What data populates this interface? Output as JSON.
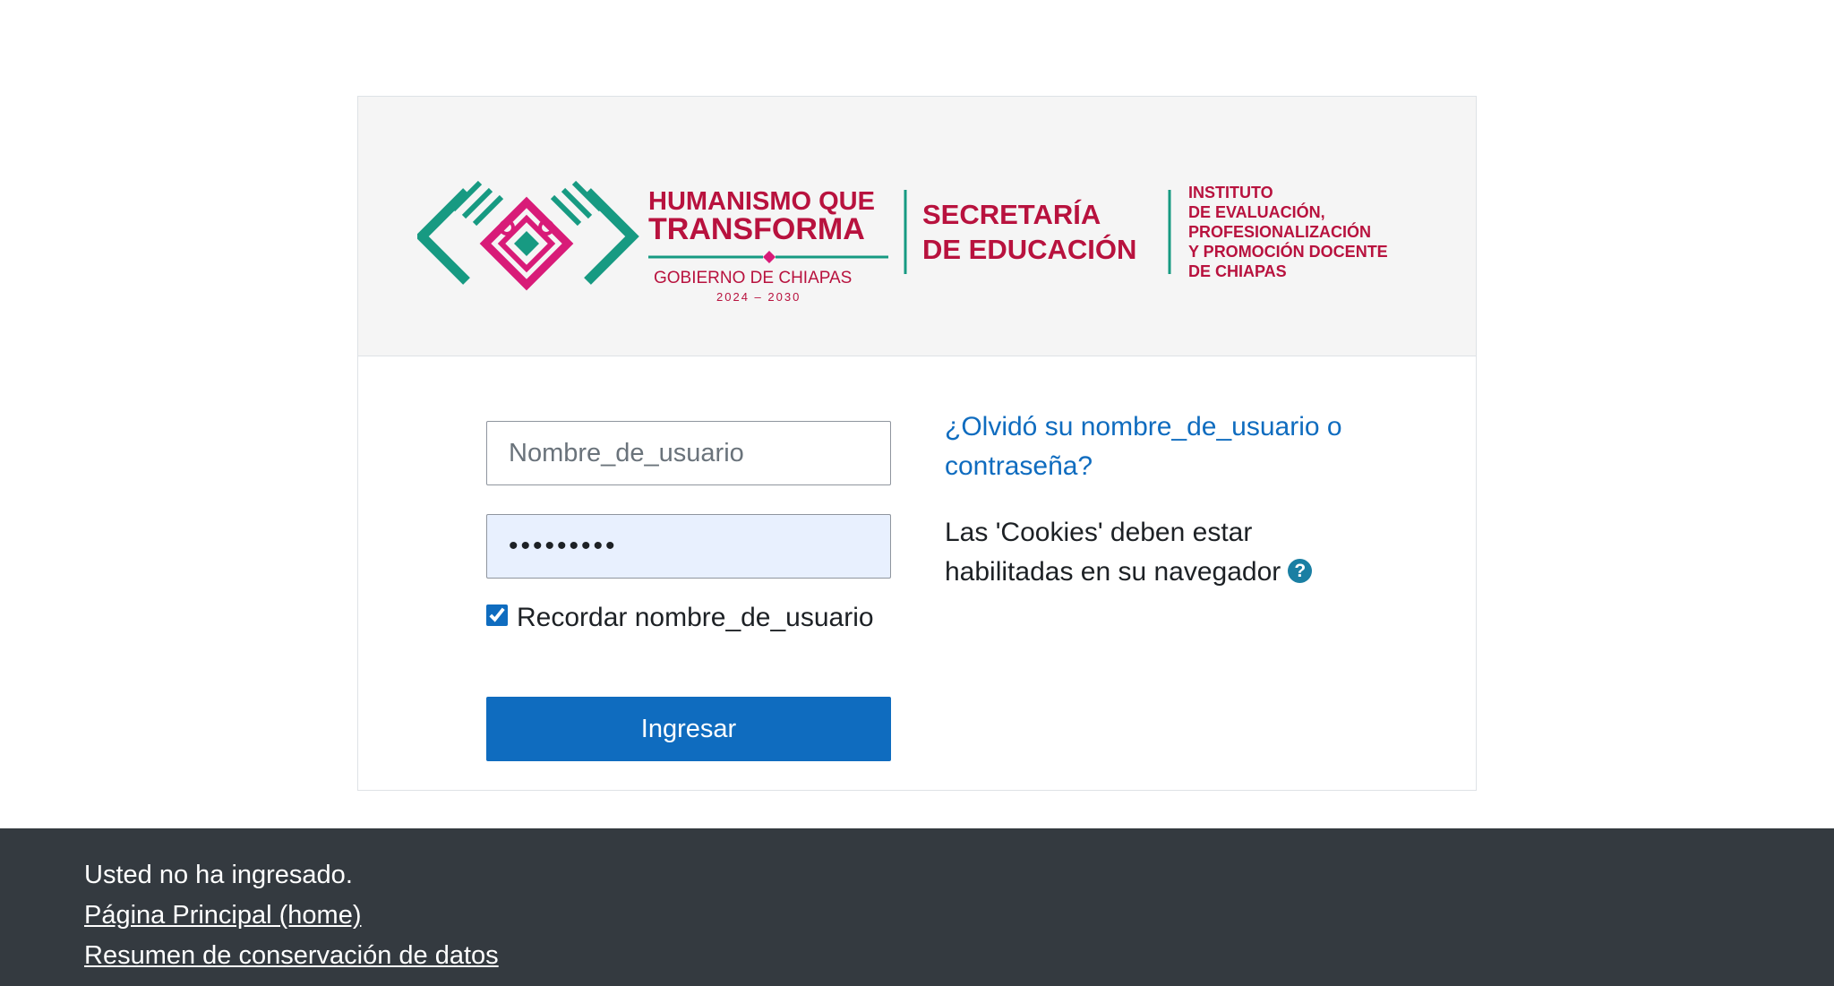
{
  "logo": {
    "motto_line1": "HUMANISMO QUE",
    "motto_line2": "TRANSFORMA",
    "government": "GOBIERNO DE CHIAPAS",
    "years": "2024 – 2030",
    "secretaria_line1": "SECRETARÍA",
    "secretaria_line2": "DE EDUCACIÓN",
    "instituto_line1": "INSTITUTO",
    "instituto_line2": "DE EVALUACIÓN,",
    "instituto_line3": "PROFESIONALIZACIÓN",
    "instituto_line4": "Y PROMOCIÓN DOCENTE",
    "instituto_line5": "DE CHIAPAS",
    "colors": {
      "brand_red": "#b8123e",
      "brand_green": "#179a82",
      "brand_pink": "#d81b78"
    }
  },
  "login": {
    "username_placeholder": "Nombre_de_usuario",
    "username_value": "",
    "password_value": "•••••••••",
    "remember_label": "Recordar nombre_de_usuario",
    "remember_checked": true,
    "submit_label": "Ingresar",
    "forgot_link": "¿Olvidó su nombre_de_usuario o contraseña?",
    "cookies_notice": "Las 'Cookies' deben estar habilitadas en su navegador",
    "help_icon": "question-circle-icon"
  },
  "footer": {
    "status": "Usted no ha ingresado.",
    "home_link": "Página Principal (home)",
    "data_retention_link": "Resumen de conservación de datos"
  },
  "colors": {
    "primary": "#0f6cbf",
    "footer_bg": "#343a40",
    "header_bg": "#f5f5f5",
    "autofill_bg": "#e8f0fe"
  }
}
